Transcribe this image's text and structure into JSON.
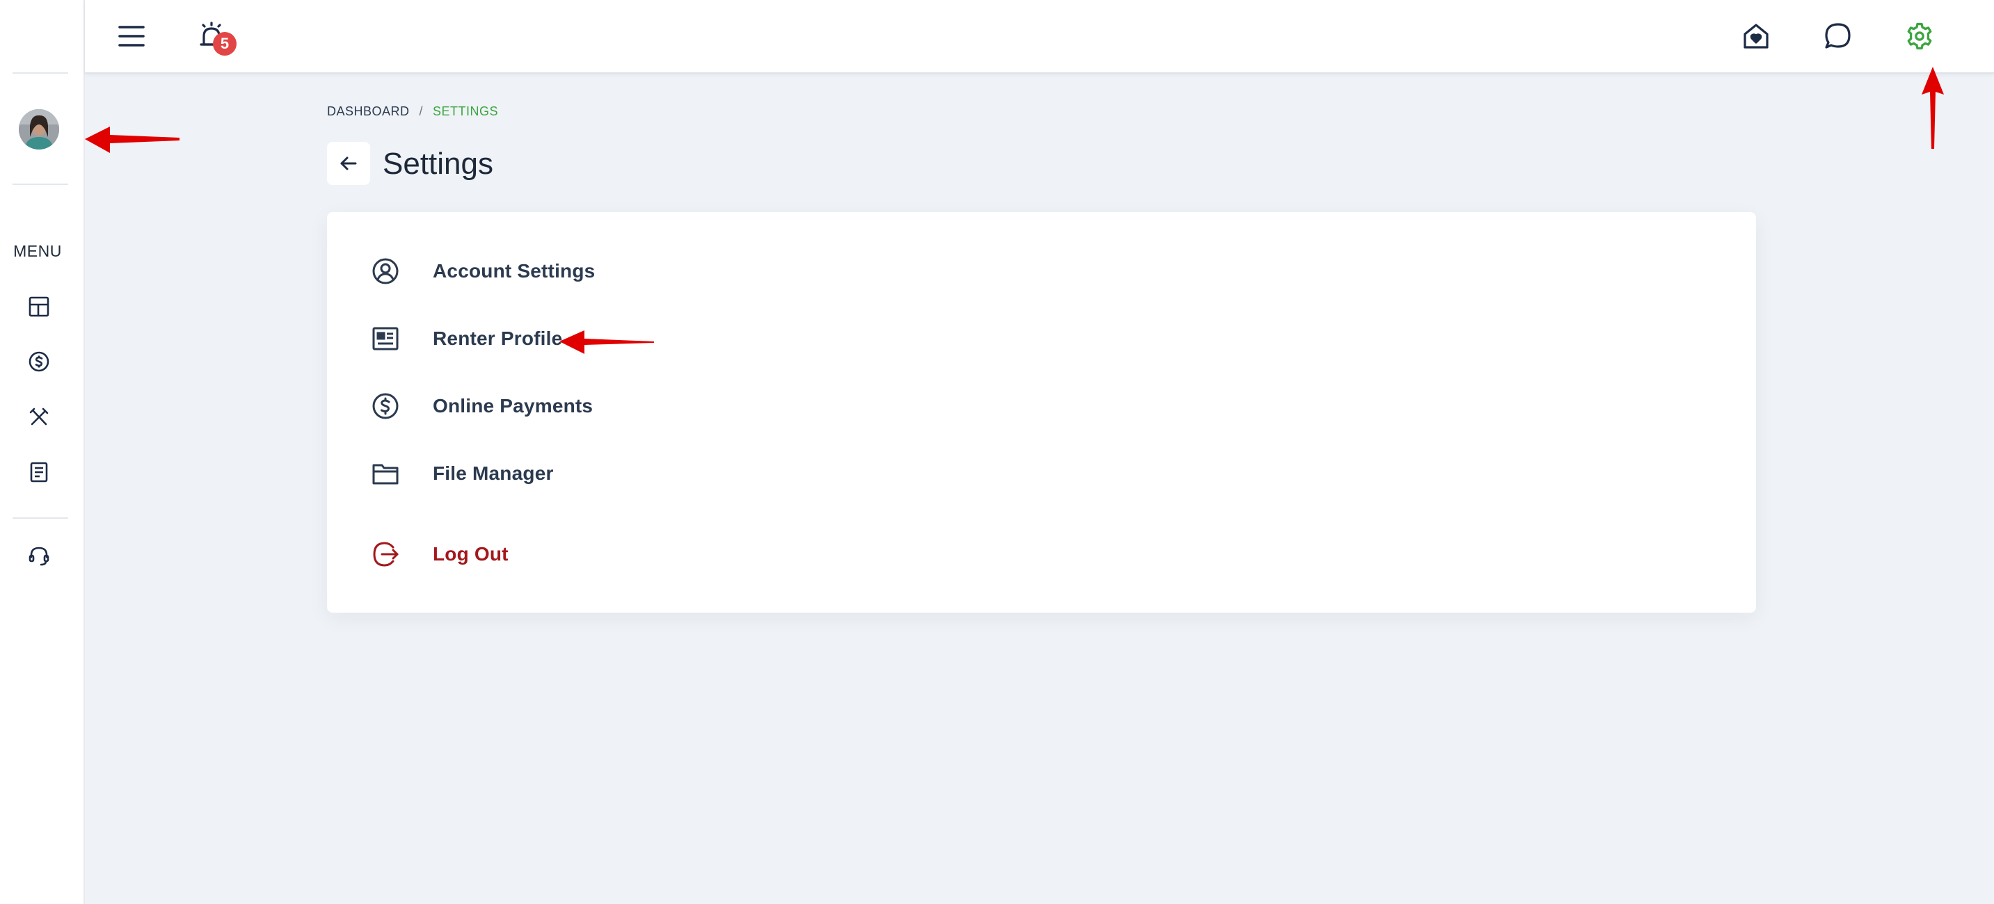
{
  "header": {
    "notification_count": "5"
  },
  "sidebar": {
    "menu_label": "MENU"
  },
  "breadcrumb": {
    "home": "DASHBOARD",
    "separator": "/",
    "current": "SETTINGS"
  },
  "page": {
    "title": "Settings"
  },
  "settings": {
    "items": [
      {
        "label": "Account Settings",
        "icon": "user-circle-icon"
      },
      {
        "label": "Renter Profile",
        "icon": "id-card-icon"
      },
      {
        "label": "Online Payments",
        "icon": "dollar-circle-icon"
      },
      {
        "label": "File Manager",
        "icon": "folder-icon"
      },
      {
        "label": "Log Out",
        "icon": "logout-icon"
      }
    ]
  },
  "colors": {
    "accent_green": "#3aa63f",
    "badge_red": "#e24545",
    "danger": "#a3181c",
    "navy": "#1d2b45",
    "annotation_red": "#e00000"
  }
}
